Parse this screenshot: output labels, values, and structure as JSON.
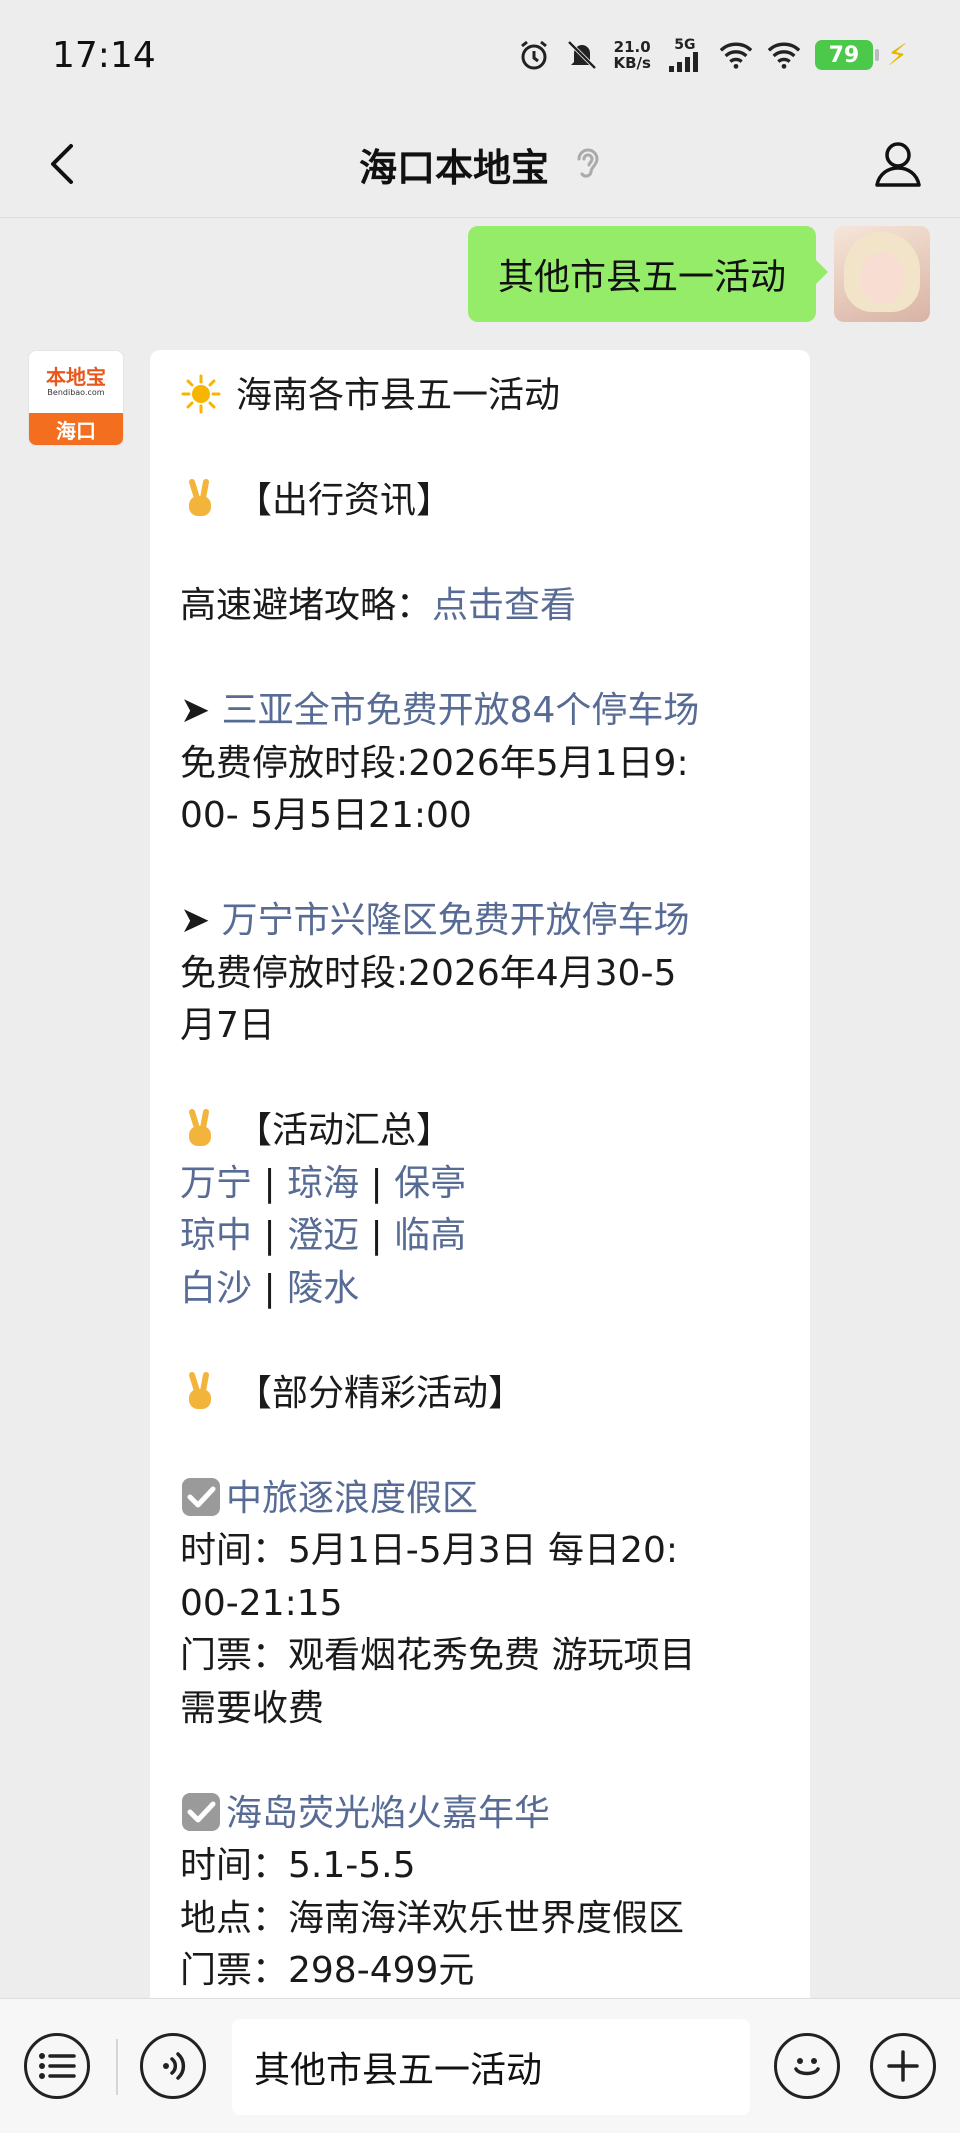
{
  "status_bar": {
    "time": "17:14",
    "net_speed_value": "21.0",
    "net_speed_unit": "KB/s",
    "network": "5G",
    "battery": "79"
  },
  "nav": {
    "title": "海口本地宝"
  },
  "outgoing_message": {
    "text": "其他市县五一活动"
  },
  "bot_avatar": {
    "logo_text": "本地宝",
    "logo_sub": "Bendibao.com",
    "city": "海口"
  },
  "reply": {
    "heading": "海南各市县五一活动",
    "travel_section": "【出行资讯】",
    "highway_label": "高速避堵攻略：",
    "highway_link": "点击查看",
    "arrow": "➤",
    "parking1_link": "三亚全市免费开放84个停车场",
    "parking1_time_a": "免费停放时段:2026年5月1日9:",
    "parking1_time_b": "00- 5月5日21:00",
    "parking2_link": "万宁市兴隆区免费开放停车场",
    "parking2_time_a": "免费停放时段:2026年4月30-5",
    "parking2_time_b": "月7日",
    "summary_section": "【活动汇总】",
    "summary_row1": [
      "万宁",
      "琼海",
      "保亭"
    ],
    "summary_row2": [
      "琼中",
      "澄迈",
      "临高"
    ],
    "summary_row3": [
      "白沙",
      "陵水"
    ],
    "separator": "|",
    "highlights_section": "【部分精彩活动】",
    "event1_title": "中旅逐浪度假区",
    "event1_time_a": "时间：5月1日-5月3日 每日20:",
    "event1_time_b": "00-21:15",
    "event1_ticket_a": "门票：观看烟花秀免费 游玩项目",
    "event1_ticket_b": "需要收费",
    "event2_title": "海岛荧光焰火嘉年华",
    "event2_time": "时间：5.1-5.5",
    "event2_location": "地点：海南海洋欢乐世界度假区",
    "event2_ticket": "门票：298-499元"
  },
  "input_bar": {
    "text": "其他市县五一活动"
  },
  "colors": {
    "link": "#576b95",
    "outgoing_bubble": "#95ec69",
    "battery": "#4cc84a",
    "brand_orange": "#f36e1f"
  }
}
